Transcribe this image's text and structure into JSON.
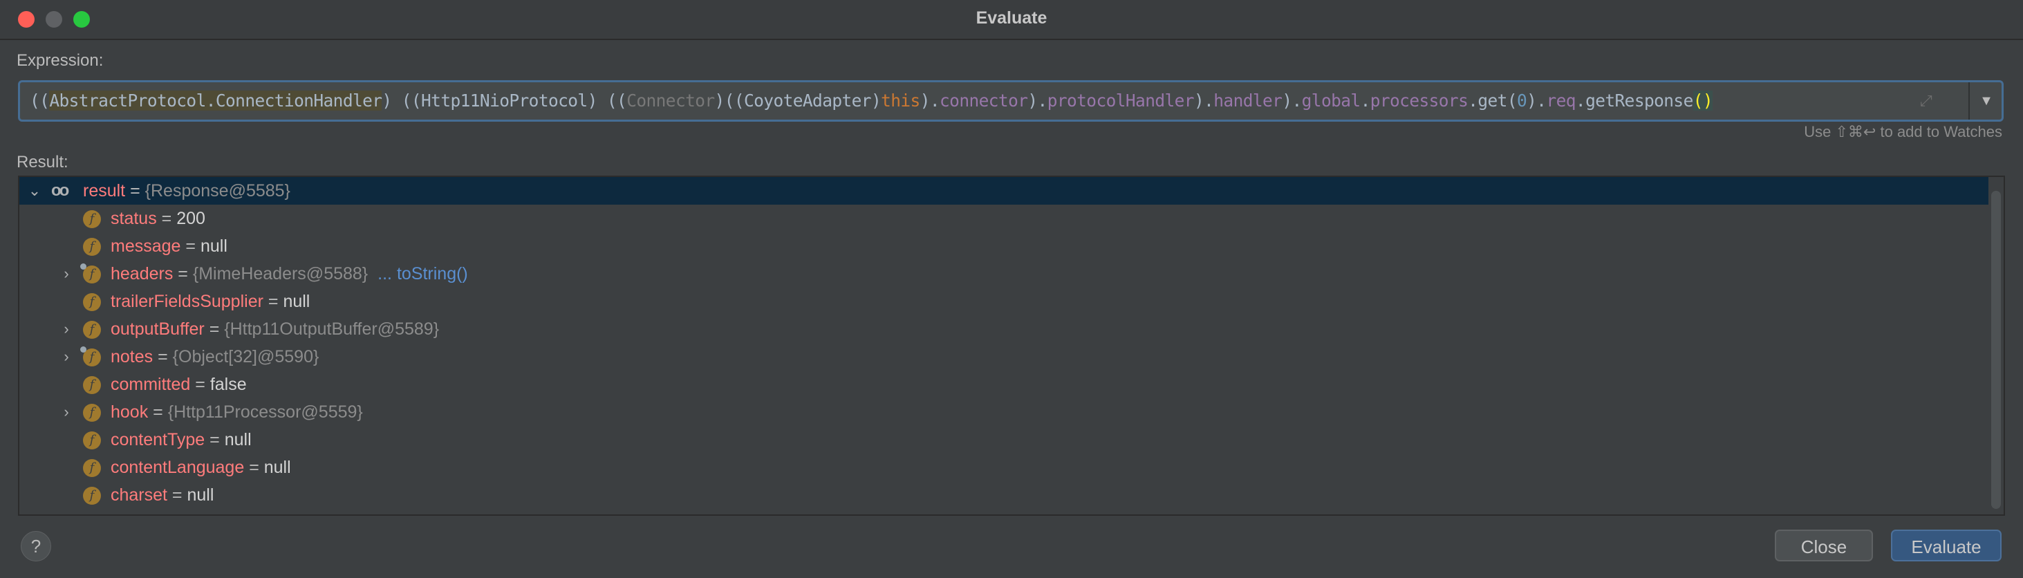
{
  "window": {
    "title": "Evaluate",
    "traffic_lights": [
      "#ff5f57",
      "#5f6164",
      "#28c840"
    ]
  },
  "expression": {
    "label": "Expression:",
    "tokens": [
      {
        "text": "((",
        "style": "plain"
      },
      {
        "text": "AbstractProtocol.ConnectionHandler",
        "style": "highlight"
      },
      {
        "text": ") ((Http11NioProtocol) ((",
        "style": "plain"
      },
      {
        "text": "Connector",
        "style": "gray"
      },
      {
        "text": ")((CoyoteAdapter)",
        "style": "plain"
      },
      {
        "text": "this",
        "style": "keyword"
      },
      {
        "text": ").",
        "style": "plain"
      },
      {
        "text": "connector",
        "style": "field"
      },
      {
        "text": ").",
        "style": "plain"
      },
      {
        "text": "protocolHandler",
        "style": "field"
      },
      {
        "text": ").",
        "style": "plain"
      },
      {
        "text": "handler",
        "style": "field"
      },
      {
        "text": ").",
        "style": "plain"
      },
      {
        "text": "global",
        "style": "field"
      },
      {
        "text": ".",
        "style": "plain"
      },
      {
        "text": "processors",
        "style": "field"
      },
      {
        "text": ".get(",
        "style": "plain"
      },
      {
        "text": "0",
        "style": "number"
      },
      {
        "text": ").",
        "style": "plain"
      },
      {
        "text": "req",
        "style": "field"
      },
      {
        "text": ".getResponse",
        "style": "plain"
      },
      {
        "text": "()",
        "style": "brace"
      }
    ],
    "hint": "Use ⇧⌘↩ to add to Watches",
    "token_colors": {
      "plain": "#a9b7c6",
      "highlight": "#a9b7c6",
      "gray": "#787878",
      "keyword": "#cc7832",
      "field": "#9876aa",
      "number": "#6897bb",
      "brace": "#ffef28"
    }
  },
  "result": {
    "label": "Result:",
    "rows": [
      {
        "name": "result",
        "value": "{Response@5585}",
        "kind": "ref",
        "expanded": true,
        "level": 0,
        "icon": "watch-glasses-icon"
      },
      {
        "name": "status",
        "value": "200",
        "kind": "prim",
        "level": 1,
        "icon": "field-icon"
      },
      {
        "name": "message",
        "value": "null",
        "kind": "prim",
        "level": 1,
        "icon": "field-icon"
      },
      {
        "name": "headers",
        "value": "{MimeHeaders@5588}",
        "kind": "ref",
        "expandable": true,
        "badge": true,
        "link": "... toString()",
        "level": 1,
        "icon": "field-icon"
      },
      {
        "name": "trailerFieldsSupplier",
        "value": "null",
        "kind": "prim",
        "level": 1,
        "icon": "field-icon"
      },
      {
        "name": "outputBuffer",
        "value": "{Http11OutputBuffer@5589}",
        "kind": "ref",
        "expandable": true,
        "level": 1,
        "icon": "field-icon"
      },
      {
        "name": "notes",
        "value": "{Object[32]@5590}",
        "kind": "ref",
        "expandable": true,
        "badge": true,
        "level": 1,
        "icon": "field-icon"
      },
      {
        "name": "committed",
        "value": "false",
        "kind": "prim",
        "level": 1,
        "icon": "field-icon"
      },
      {
        "name": "hook",
        "value": "{Http11Processor@5559}",
        "kind": "ref",
        "expandable": true,
        "level": 1,
        "icon": "field-icon"
      },
      {
        "name": "contentType",
        "value": "null",
        "kind": "prim",
        "level": 1,
        "icon": "field-icon"
      },
      {
        "name": "contentLanguage",
        "value": "null",
        "kind": "prim",
        "level": 1,
        "icon": "field-icon"
      },
      {
        "name": "charset",
        "value": "null",
        "kind": "prim",
        "level": 1,
        "icon": "field-icon"
      }
    ]
  },
  "footer": {
    "help": "?",
    "close_label": "Close",
    "evaluate_label": "Evaluate"
  }
}
